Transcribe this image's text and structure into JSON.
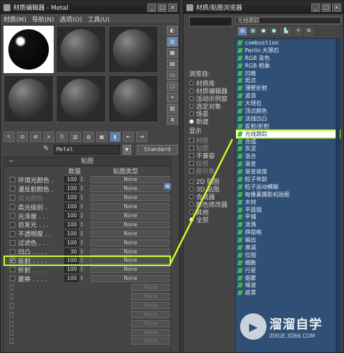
{
  "left_window": {
    "title": "材质编辑器 - Metal",
    "controls": [
      "_",
      "□",
      "×"
    ],
    "menu": [
      "材质(M)",
      "导航(N)",
      "选项(O)",
      "工具(U)"
    ],
    "side_tools": [
      "◐",
      "◍",
      "▦",
      "▤",
      "▭",
      "▢",
      "⌖",
      "▨",
      "⧈"
    ],
    "bottom_tools": [
      "↖",
      "⊘",
      "⊗",
      "×",
      "⎘",
      "▥",
      "◍",
      "▣",
      "▮",
      "⇤",
      "⇥"
    ],
    "material_name": "Metal",
    "material_type": "Standard",
    "rollout_title": "贴图",
    "col_amount": "数量",
    "col_maptype": "贴图类型",
    "map_rows": [
      {
        "name": "环境光颜色 .",
        "amount": "100",
        "map": "None",
        "checked": false,
        "dim": false
      },
      {
        "name": "漫反射颜色 .",
        "amount": "100",
        "map": "None",
        "checked": false,
        "dim": false
      },
      {
        "name": "高光颜色 .",
        "amount": "100",
        "map": "None",
        "checked": false,
        "dim": true
      },
      {
        "name": "高光级别 .",
        "amount": "100",
        "map": "None",
        "checked": false,
        "dim": false
      },
      {
        "name": "光泽度 . . .",
        "amount": "100",
        "map": "None",
        "checked": false,
        "dim": false
      },
      {
        "name": "自发光 . . .",
        "amount": "100",
        "map": "None",
        "checked": false,
        "dim": false
      },
      {
        "name": "不透明度 . .",
        "amount": "100",
        "map": "None",
        "checked": false,
        "dim": false
      },
      {
        "name": "过滤色 . . .",
        "amount": "100",
        "map": "None",
        "checked": false,
        "dim": false
      },
      {
        "name": "凹凸 . . . .",
        "amount": "30",
        "map": "None",
        "checked": false,
        "dim": false
      },
      {
        "name": "反射 . . . .",
        "amount": "100",
        "map": "None",
        "checked": true,
        "dim": false
      },
      {
        "name": "折射 . . . .",
        "amount": "100",
        "map": "None",
        "checked": false,
        "dim": false
      },
      {
        "name": "置换 . . . .",
        "amount": "100",
        "map": "None",
        "checked": false,
        "dim": false
      },
      {
        "name": "",
        "amount": "",
        "map": "None",
        "checked": false,
        "dim": true
      },
      {
        "name": "",
        "amount": "",
        "map": "None",
        "checked": false,
        "dim": true
      },
      {
        "name": "",
        "amount": "",
        "map": "None",
        "checked": false,
        "dim": true
      },
      {
        "name": "",
        "amount": "",
        "map": "None",
        "checked": false,
        "dim": true
      },
      {
        "name": "",
        "amount": "",
        "map": "None",
        "checked": false,
        "dim": true
      },
      {
        "name": "",
        "amount": "",
        "map": "None",
        "checked": false,
        "dim": true
      },
      {
        "name": "",
        "amount": "",
        "map": "None",
        "checked": false,
        "dim": true
      }
    ]
  },
  "right_window": {
    "title": "材质/贴图浏览器",
    "controls": [
      "_",
      "□",
      "×"
    ],
    "search_value": "光线跟踪",
    "toolbar": [
      "▤",
      "▦",
      "●",
      "●",
      "▙",
      "✕",
      "⧉"
    ],
    "browse_label": "浏览自:",
    "browse_from": [
      {
        "label": "材质库",
        "on": false
      },
      {
        "label": "材质编辑器",
        "on": false
      },
      {
        "label": "活动示例窗",
        "on": false
      },
      {
        "label": "选定对象",
        "on": false
      },
      {
        "label": "场景",
        "on": false
      },
      {
        "label": "新建",
        "on": true
      }
    ],
    "show_label": "显示",
    "show_items": [
      {
        "label": "材质",
        "dim": true
      },
      {
        "label": "贴图",
        "dim": true
      },
      {
        "label": "不兼容",
        "dim": false
      },
      {
        "label": "仅根",
        "dim": true
      },
      {
        "label": "按对象",
        "dim": true
      }
    ],
    "category_items": [
      {
        "label": "2D 贴图",
        "on": false
      },
      {
        "label": "3D 贴图",
        "on": false
      },
      {
        "label": "合成器",
        "on": false
      },
      {
        "label": "颜色修改器",
        "on": false
      },
      {
        "label": "其他",
        "on": false
      },
      {
        "label": "全部",
        "on": true
      }
    ],
    "map_list": [
      "combustion",
      "Perlin 大理石",
      "RGB 染色",
      "RGB 相乘",
      "凹痕",
      "斑点",
      "薄壁折射",
      "波浪",
      "大理石",
      "顶点颜色",
      "法线凹凸",
      "反射/折射",
      "光线跟踪",
      "合成",
      "灰泥",
      "混合",
      "渐变",
      "渐变坡度",
      "粒子年龄",
      "粒子运动模糊",
      "每像素摄影机贴图",
      "木材",
      "平面镜",
      "平铺",
      "泼溅",
      "棋盘格",
      "输出",
      "衰减",
      "位图",
      "细胞",
      "行星",
      "烟雾",
      "噪波",
      "遮罩"
    ],
    "selected_index": 12
  },
  "watermark": {
    "title": "溜溜自学",
    "url": "ZIXUE.3D66.COM"
  },
  "colors": {
    "highlight": "#c8ff2a",
    "browser_bg": "#2f4f74",
    "selected_text": "#1b3d7c"
  }
}
